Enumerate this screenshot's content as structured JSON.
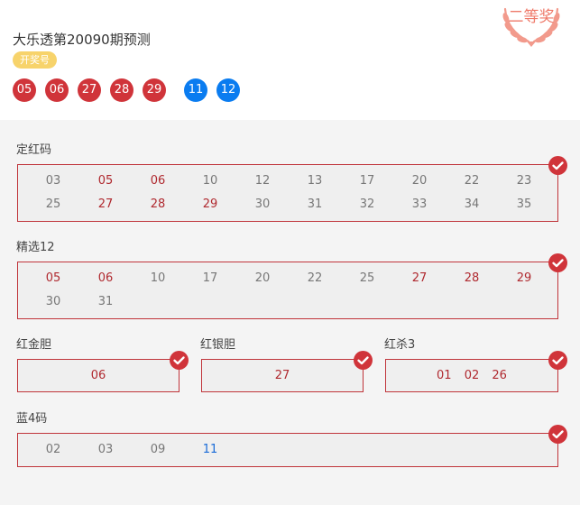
{
  "header": {
    "title": "大乐透第20090期预测",
    "draw_label": "开奖号",
    "red_balls": [
      "05",
      "06",
      "27",
      "28",
      "29"
    ],
    "blue_balls": [
      "11",
      "12"
    ],
    "prize_text": "二等奖"
  },
  "sections": {
    "ding_hong": {
      "label": "定红码",
      "numbers": [
        "03",
        "05",
        "06",
        "10",
        "12",
        "13",
        "17",
        "20",
        "22",
        "23",
        "25",
        "27",
        "28",
        "29",
        "30",
        "31",
        "32",
        "33",
        "34",
        "35"
      ],
      "hits": [
        "05",
        "06",
        "27",
        "28",
        "29"
      ],
      "result": "correct"
    },
    "jing_xuan": {
      "label": "精选12",
      "numbers": [
        "05",
        "06",
        "10",
        "17",
        "20",
        "22",
        "25",
        "27",
        "28",
        "29",
        "30",
        "31"
      ],
      "hits": [
        "05",
        "06",
        "27",
        "28",
        "29"
      ],
      "result": "correct"
    },
    "hong_jin_dan": {
      "label": "红金胆",
      "numbers": [
        "06"
      ],
      "result": "correct"
    },
    "hong_yin_dan": {
      "label": "红银胆",
      "numbers": [
        "27"
      ],
      "result": "correct"
    },
    "hong_sha": {
      "label": "红杀3",
      "numbers": [
        "01",
        "02",
        "26"
      ],
      "result": "correct"
    },
    "lan_ma": {
      "label": "蓝4码",
      "numbers": [
        "02",
        "03",
        "09",
        "11"
      ],
      "hits": [
        "11"
      ],
      "result": "correct"
    }
  },
  "colors": {
    "red": "#d0343a",
    "blue": "#0a7cf0",
    "badge": "#f7d36b",
    "prize": "#ef7a6a"
  }
}
